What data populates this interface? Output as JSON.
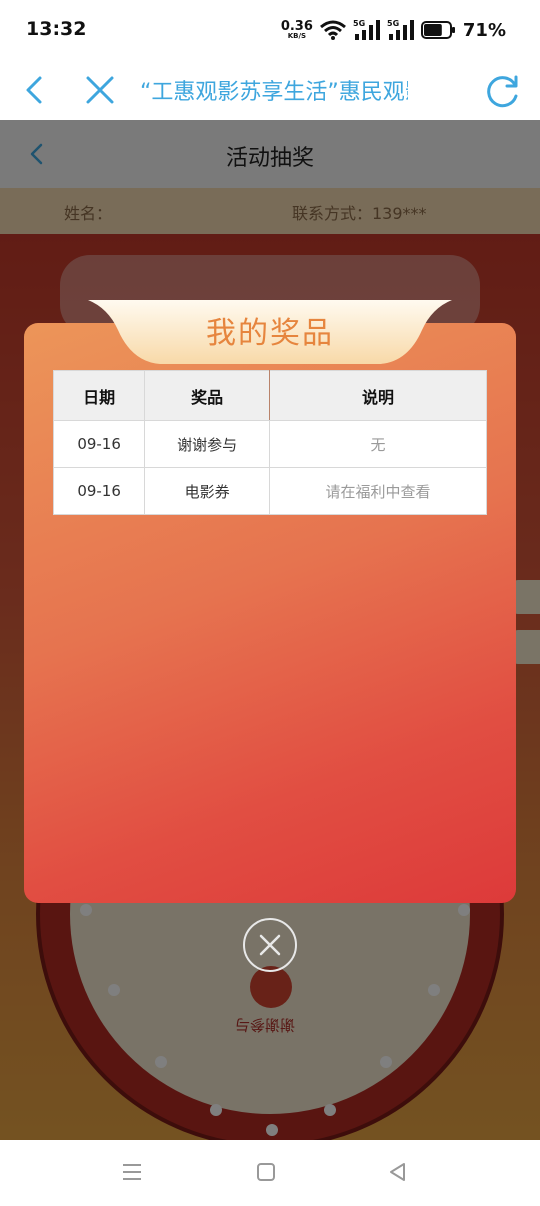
{
  "status_bar": {
    "time": "13:32",
    "net_speed_value": "0.36",
    "net_speed_unit": "KB/S",
    "signal_label_1": "5G",
    "signal_label_2": "5G",
    "battery_percent": "71%",
    "battery_level": 0.71
  },
  "browser_bar": {
    "title": "“工惠观影苏享生活”惠民观影",
    "accent_color": "#3ea6de"
  },
  "page": {
    "header_title": "活动抽奖",
    "info_name_label": "姓名：",
    "info_contact": "联系方式：139***",
    "wheel_slice_label": "谢谢参与"
  },
  "modal": {
    "title": "我的奖品",
    "columns": [
      "日期",
      "奖品",
      "说明"
    ],
    "rows": [
      {
        "date": "09-16",
        "prize": "谢谢参与",
        "desc": "无"
      },
      {
        "date": "09-16",
        "prize": "电影券",
        "desc": "请在福利中查看"
      }
    ]
  },
  "icons": {
    "back": "chevron-left-icon",
    "close": "close-icon",
    "refresh": "refresh-icon",
    "modal_close": "circle-close-icon",
    "nav_menu": "menu-icon",
    "nav_home": "home-icon",
    "nav_back": "triangle-back-icon"
  }
}
